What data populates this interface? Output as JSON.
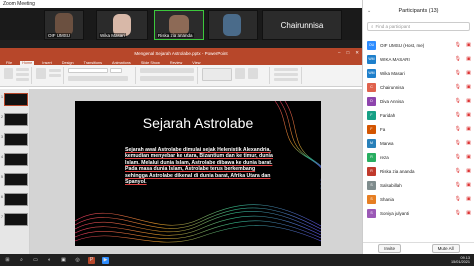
{
  "zoom": {
    "title": "Zoom Meeting",
    "tiles": [
      {
        "name": "OIF UMSU"
      },
      {
        "name": "Wika Masari"
      },
      {
        "name": "Riska zia ananda"
      },
      {
        "name": "Chairunnisa"
      }
    ]
  },
  "ppt": {
    "title": "Mengenal Sejarah Astrolabe.pptx - PowerPoint",
    "tabs": [
      "File",
      "Home",
      "Insert",
      "Design",
      "Transitions",
      "Animations",
      "Slide Show",
      "Review",
      "View"
    ],
    "active_tab": "Home",
    "slide_numbers": [
      "1",
      "2",
      "3",
      "4",
      "5",
      "6",
      "7"
    ],
    "status_left": "Slide 1 of 11",
    "status_lang": "English (United States)",
    "slide": {
      "title": "Sejarah Astrolabe",
      "body": "Sejarah awal Astrolabe dimulai sejak Helenistik Alexandria, kemudian menyebar ke utara, Bizantium dan ke timur, dunia Islam. Melalui dunia Islam, Astrolabe dibawa ke dunia barat. Pada masa dunia Islam, Astrolabe terus berkembang sehingga Astrolabe dikenal di dunia barat, Afrika Utara dan Spanyol."
    }
  },
  "participants": {
    "header": "Participants (13)",
    "search_placeholder": "Find a participant",
    "list": [
      {
        "initials": "OU",
        "name": "OIF UMSU (Host, me)",
        "color": "#2d8cff"
      },
      {
        "initials": "WM",
        "name": "WIKA MASARI",
        "color": "#1e7fcb"
      },
      {
        "initials": "WM",
        "name": "Wika Masari",
        "color": "#1e7fcb"
      },
      {
        "initials": "C",
        "name": "Chairunnisa",
        "color": "#e0624d"
      },
      {
        "initials": "D",
        "name": "Diva Annisa",
        "color": "#8e44ad"
      },
      {
        "initials": "F",
        "name": "Faridah",
        "color": "#16a085"
      },
      {
        "initials": "F",
        "name": "Fa",
        "color": "#d35400"
      },
      {
        "initials": "M",
        "name": "Marwa",
        "color": "#2980b9"
      },
      {
        "initials": "R",
        "name": "reza",
        "color": "#27ae60"
      },
      {
        "initials": "R",
        "name": "Riska zia ananda",
        "color": "#c0392b"
      },
      {
        "initials": "S",
        "name": "Salsabillah",
        "color": "#7f8c8d"
      },
      {
        "initials": "S",
        "name": "Shania",
        "color": "#e67e22"
      },
      {
        "initials": "S",
        "name": "Soniya julyanti",
        "color": "#9b59b6"
      }
    ],
    "invite": "Invite",
    "mute_all": "Mute All"
  },
  "taskbar": {
    "time": "09.13",
    "date": "15/01/2021"
  }
}
